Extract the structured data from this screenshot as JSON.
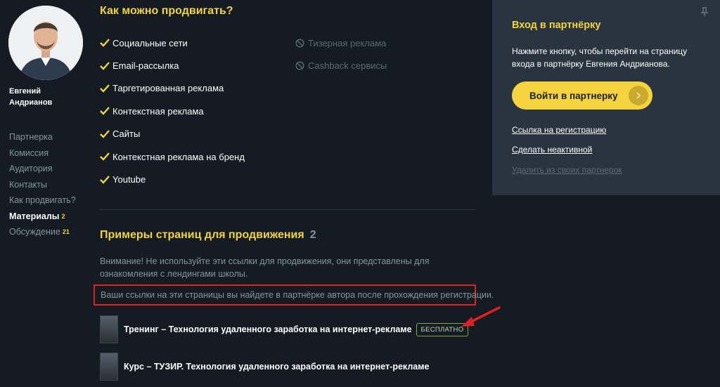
{
  "sidebar": {
    "author_name": "Евгений Андрианов",
    "nav": [
      {
        "label": "Партнерка",
        "count": ""
      },
      {
        "label": "Комиссия",
        "count": ""
      },
      {
        "label": "Аудитория",
        "count": ""
      },
      {
        "label": "Контакты",
        "count": ""
      },
      {
        "label": "Как продвигать?",
        "count": ""
      },
      {
        "label": "Материалы",
        "count": "2"
      },
      {
        "label": "Обсуждение",
        "count": "21"
      }
    ]
  },
  "promotion": {
    "title": "Как можно продвигать?",
    "allowed": [
      "Социальные сети",
      "Email-рассылка",
      "Таргетированная реклама",
      "Контекстная реклама",
      "Сайты",
      "Контекстная реклама на бренд",
      "Youtube"
    ],
    "forbidden": [
      "Тизерная реклама",
      "Cashback сервисы"
    ]
  },
  "examples": {
    "title": "Примеры страниц для продвижения",
    "count": "2",
    "notice": "Внимание! Не используйте эти ссылки для продвижения, они представлены для ознакомления с лендингами школы.",
    "highlight": "Ваши ссылки на эти страницы вы найдете в партнёрке автора после прохождения регистрации.",
    "products": [
      {
        "title": "Тренинг – Технология удаленного заработка на интернет-рекламе",
        "badge": "БЕСПЛАТНО"
      },
      {
        "title": "Курс – ТУЗИР. Технология удаленного заработка на интернет-рекламе",
        "badge": ""
      }
    ]
  },
  "panel": {
    "title": "Вход в партнёрку",
    "description": "Нажмите кнопку, чтобы перейти на страницу входа в партнёрку Евгения Андрианова.",
    "button_label": "Войти в партнерку",
    "link_register": "Ссылка на регистрацию",
    "link_deactivate": "Сделать неактивной",
    "link_remove": "Удалить из своих партнерок"
  },
  "colors": {
    "accent": "#f2d43d",
    "background": "#141b22",
    "panel": "#2a3440",
    "highlight_border": "#e02020",
    "badge_border": "#78a83a"
  }
}
